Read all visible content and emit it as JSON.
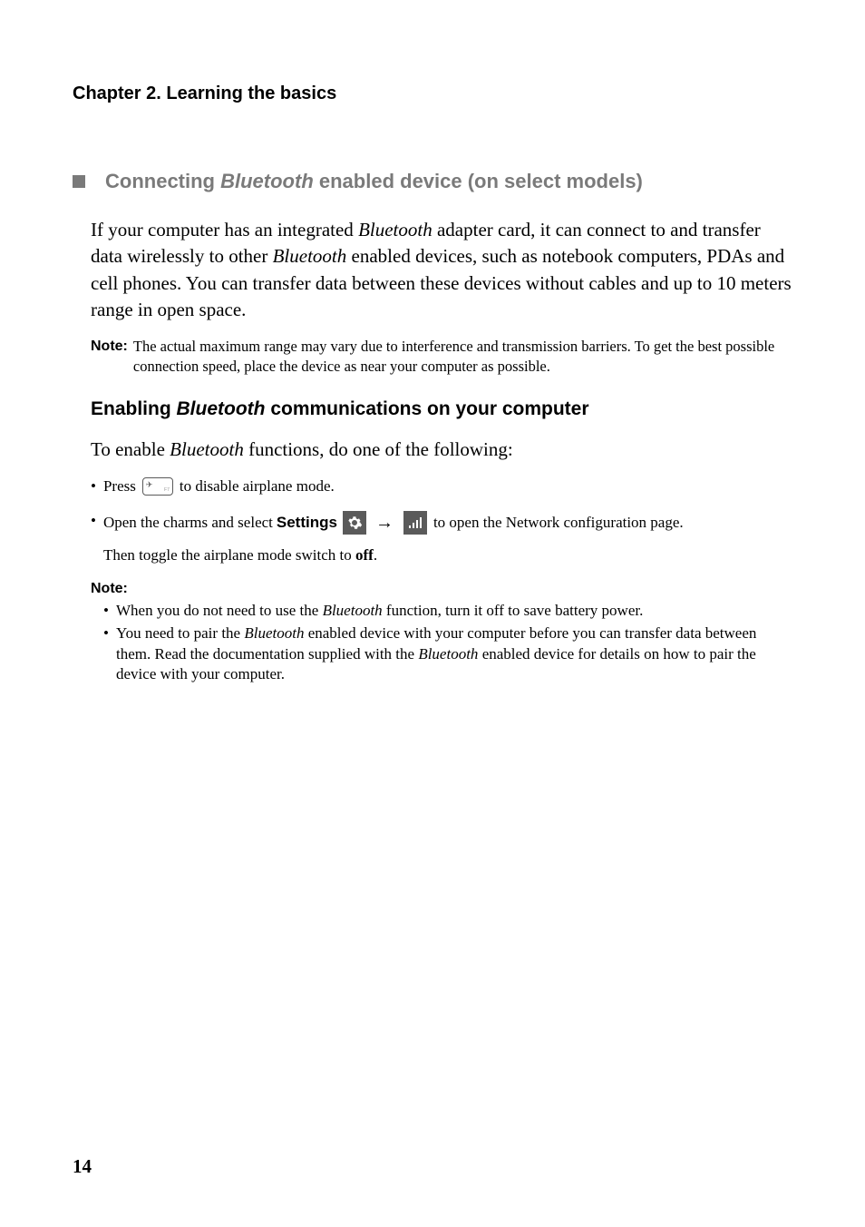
{
  "chapter": "Chapter 2. Learning the basics",
  "section": {
    "prefix": "Connecting ",
    "italic": "Bluetooth",
    "suffix": " enabled device (on select models)"
  },
  "para1": {
    "p1a": "If your computer has an integrated ",
    "p1b": "Bluetooth",
    "p1c": " adapter card, it can connect to and transfer data wirelessly to other ",
    "p1d": "Bluetooth",
    "p1e": " enabled devices, such as notebook computers, PDAs and cell phones. You can transfer data between these devices without cables and up to 10 meters range in open space."
  },
  "note1": {
    "label": "Note:",
    "text": "The actual maximum range may vary due to interference and transmission barriers. To get the best possible connection speed, place the device as near your computer as possible."
  },
  "subheading": {
    "a": "Enabling ",
    "b": "Bluetooth",
    "c": " communications on your computer"
  },
  "para2": {
    "a": "To enable ",
    "b": "Bluetooth",
    "c": " functions, do one of the following:"
  },
  "bullet1": {
    "a": "Press ",
    "b": " to disable airplane mode."
  },
  "bullet2": {
    "a": "Open the charms and select ",
    "settings": "Settings",
    "b": " to open the Network configuration page.",
    "c": "Then toggle the airplane mode switch to ",
    "off": "off",
    "d": "."
  },
  "note2": {
    "label": "Note:",
    "item1": {
      "a": "When you do not need to use the ",
      "b": "Bluetooth",
      "c": " function, turn it off to save battery power."
    },
    "item2": {
      "a": "You need to pair the ",
      "b": "Bluetooth",
      "c": " enabled device with your computer before you can transfer data between them. Read the documentation supplied with the ",
      "d": "Bluetooth",
      "e": " enabled device for details on how to pair the device with your computer."
    }
  },
  "pageNumber": "14"
}
